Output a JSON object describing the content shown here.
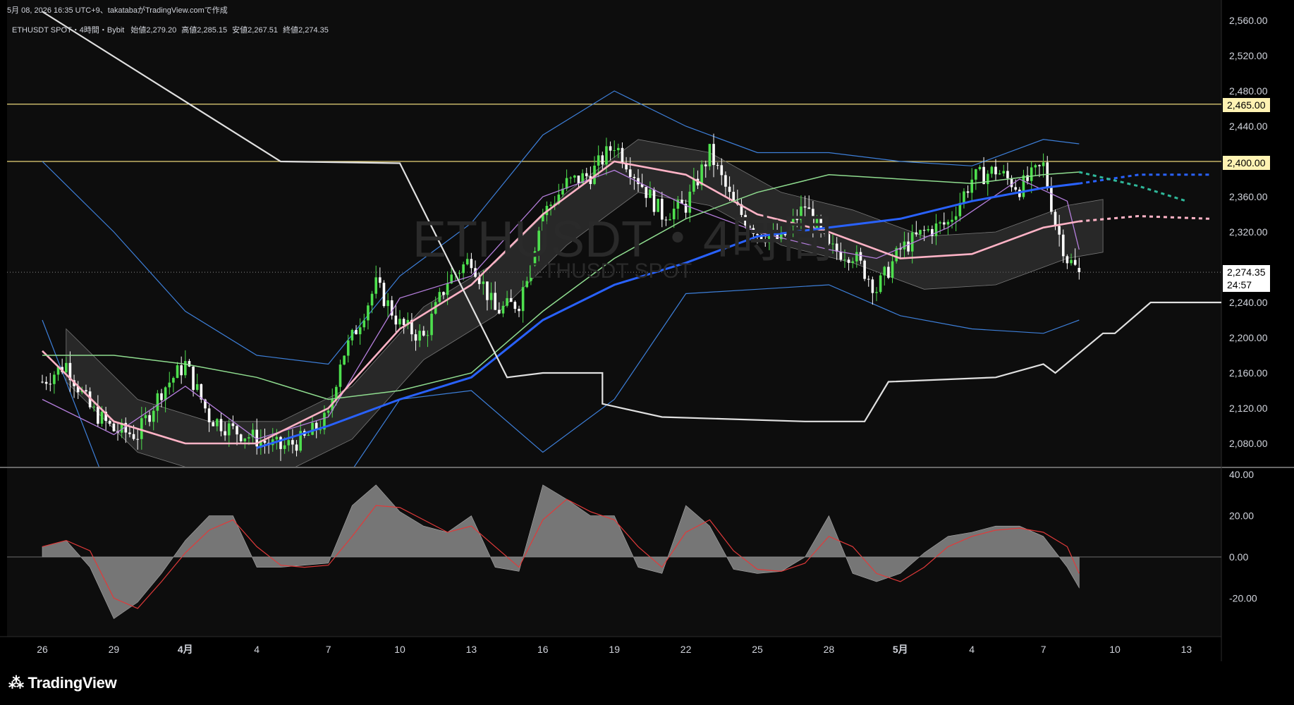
{
  "header": {
    "created_line": "5月 08, 2026 16:35 UTC+9、takatabaがTradingView.comで作成",
    "symbol_line": "ETHUSDT SPOT・4時間・Bybit",
    "open_label": "始値",
    "open_value": "2,279.20",
    "high_label": "高値",
    "high_value": "2,285.15",
    "low_label": "安値",
    "low_value": "2,267.51",
    "close_label": "終値",
    "close_value": "2,274.35"
  },
  "watermark": {
    "line1": "ETHUSDT・4時間",
    "line2": "ETHUSDT SPOT"
  },
  "price_scale": {
    "ticks": [
      "2,560.00",
      "2,520.00",
      "2,480.00",
      "2,440.00",
      "2,360.00",
      "2,320.00",
      "2,240.00",
      "2,200.00",
      "2,160.00",
      "2,120.00",
      "2,080.00"
    ],
    "tick_values": [
      2560,
      2520,
      2480,
      2440,
      2360,
      2320,
      2240,
      2200,
      2160,
      2120,
      2080
    ],
    "resistance_1": "2,465.00",
    "resistance_2": "2,400.00",
    "last_price": "2,274.35",
    "countdown": "24:57"
  },
  "oscillator_scale": {
    "ticks": [
      "40.00",
      "20.00",
      "0.00",
      "-20.00"
    ],
    "tick_values": [
      40,
      20,
      0,
      -20
    ]
  },
  "time_axis": {
    "labels": [
      "26",
      "29",
      "4月",
      "4",
      "7",
      "10",
      "13",
      "16",
      "19",
      "22",
      "25",
      "28",
      "5月",
      "4",
      "7",
      "10",
      "13"
    ],
    "positions": [
      0,
      3,
      6,
      9,
      12,
      15,
      18,
      21,
      24,
      27,
      30,
      33,
      36,
      39,
      42,
      45,
      48
    ],
    "bold": [
      false,
      false,
      true,
      false,
      false,
      false,
      false,
      false,
      false,
      false,
      false,
      false,
      true,
      false,
      false,
      false,
      false
    ]
  },
  "brand": "TradingView",
  "colors": {
    "background": "#000000",
    "bull": "#4ee04e",
    "bear": "#ffffff",
    "ma_fast": "#b57edc",
    "ma_mid": "#ffb3c6",
    "ma_slow": "#2962ff",
    "ma_green": "#8fdc8f",
    "bollinger": "#3d7fd9",
    "chikou": "#e0e0e0",
    "level_line": "#e8d47a",
    "macd_hist": "#8a8a8a",
    "macd_signal": "#e03a3a"
  },
  "chart_data": [
    {
      "type": "candlestick",
      "symbol": "ETHUSDT SPOT",
      "interval": "4時間",
      "exchange": "Bybit",
      "x_unit": "days since Mar 26, 2026 00:00",
      "ylim": [
        2060,
        2570
      ],
      "horizontal_levels": [
        2465,
        2400
      ],
      "last": {
        "open": 2279.2,
        "high": 2285.15,
        "low": 2267.51,
        "close": 2274.35
      },
      "candle_anchor_points": [
        [
          0,
          2150
        ],
        [
          1,
          2170
        ],
        [
          2,
          2120
        ],
        [
          3,
          2095
        ],
        [
          4,
          2090
        ],
        [
          5,
          2140
        ],
        [
          6,
          2170
        ],
        [
          7,
          2110
        ],
        [
          8,
          2095
        ],
        [
          9,
          2085
        ],
        [
          10,
          2075
        ],
        [
          11,
          2085
        ],
        [
          12,
          2110
        ],
        [
          12.5,
          2175
        ],
        [
          13,
          2200
        ],
        [
          14,
          2260
        ],
        [
          15,
          2215
        ],
        [
          16,
          2200
        ],
        [
          17,
          2265
        ],
        [
          18,
          2290
        ],
        [
          19,
          2230
        ],
        [
          20,
          2240
        ],
        [
          21,
          2340
        ],
        [
          22,
          2375
        ],
        [
          23,
          2385
        ],
        [
          24,
          2420
        ],
        [
          25,
          2380
        ],
        [
          26,
          2340
        ],
        [
          27,
          2350
        ],
        [
          28,
          2410
        ],
        [
          29,
          2350
        ],
        [
          30,
          2320
        ],
        [
          31,
          2310
        ],
        [
          32,
          2350
        ],
        [
          33,
          2300
        ],
        [
          34,
          2295
        ],
        [
          35,
          2255
        ],
        [
          36,
          2300
        ],
        [
          37,
          2320
        ],
        [
          38,
          2330
        ],
        [
          39,
          2380
        ],
        [
          40,
          2390
        ],
        [
          41,
          2370
        ],
        [
          42,
          2395
        ],
        [
          42.5,
          2330
        ],
        [
          43,
          2290
        ],
        [
          43.5,
          2274.35
        ]
      ],
      "moving_averages": [
        {
          "name": "fast",
          "points": [
            [
              0,
              2130
            ],
            [
              3,
              2090
            ],
            [
              6,
              2145
            ],
            [
              9,
              2085
            ],
            [
              12,
              2110
            ],
            [
              15,
              2245
            ],
            [
              18,
              2270
            ],
            [
              21,
              2360
            ],
            [
              24,
              2390
            ],
            [
              27,
              2350
            ],
            [
              30,
              2320
            ],
            [
              33,
              2300
            ],
            [
              35,
              2290
            ],
            [
              38,
              2325
            ],
            [
              41,
              2380
            ],
            [
              43,
              2355
            ],
            [
              43.5,
              2300
            ]
          ]
        },
        {
          "name": "mid",
          "points": [
            [
              0,
              2185
            ],
            [
              3,
              2105
            ],
            [
              6,
              2080
            ],
            [
              9,
              2080
            ],
            [
              12,
              2120
            ],
            [
              15,
              2210
            ],
            [
              18,
              2260
            ],
            [
              21,
              2340
            ],
            [
              24,
              2400
            ],
            [
              27,
              2385
            ],
            [
              30,
              2340
            ],
            [
              33,
              2320
            ],
            [
              36,
              2290
            ],
            [
              39,
              2295
            ],
            [
              42,
              2325
            ],
            [
              43.5,
              2332
            ]
          ]
        },
        {
          "name": "slow",
          "points": [
            [
              9,
              2075
            ],
            [
              12,
              2100
            ],
            [
              15,
              2130
            ],
            [
              18,
              2155
            ],
            [
              21,
              2220
            ],
            [
              24,
              2260
            ],
            [
              27,
              2285
            ],
            [
              30,
              2315
            ],
            [
              33,
              2325
            ],
            [
              36,
              2335
            ],
            [
              39,
              2355
            ],
            [
              42,
              2370
            ],
            [
              43.5,
              2375
            ]
          ]
        },
        {
          "name": "green",
          "points": [
            [
              0,
              2180
            ],
            [
              3,
              2180
            ],
            [
              6,
              2170
            ],
            [
              9,
              2155
            ],
            [
              12,
              2130
            ],
            [
              15,
              2140
            ],
            [
              18,
              2160
            ],
            [
              21,
              2230
            ],
            [
              24,
              2290
            ],
            [
              27,
              2335
            ],
            [
              30,
              2365
            ],
            [
              33,
              2385
            ],
            [
              36,
              2380
            ],
            [
              39,
              2375
            ],
            [
              42,
              2385
            ],
            [
              43.5,
              2388
            ]
          ]
        }
      ],
      "projections": [
        {
          "name": "slow_proj",
          "points": [
            [
              43.5,
              2375
            ],
            [
              46,
              2385
            ],
            [
              49,
              2385
            ]
          ]
        },
        {
          "name": "mid_proj",
          "points": [
            [
              43.5,
              2332
            ],
            [
              46,
              2338
            ],
            [
              49,
              2335
            ]
          ]
        },
        {
          "name": "green_proj",
          "points": [
            [
              43.5,
              2388
            ],
            [
              46,
              2372
            ],
            [
              48,
              2355
            ]
          ]
        }
      ],
      "bollinger": {
        "upper": [
          [
            0,
            2400
          ],
          [
            3,
            2320
          ],
          [
            6,
            2230
          ],
          [
            9,
            2180
          ],
          [
            12,
            2170
          ],
          [
            15,
            2270
          ],
          [
            18,
            2330
          ],
          [
            21,
            2430
          ],
          [
            24,
            2480
          ],
          [
            27,
            2440
          ],
          [
            30,
            2410
          ],
          [
            33,
            2410
          ],
          [
            36,
            2400
          ],
          [
            39,
            2395
          ],
          [
            42,
            2425
          ],
          [
            43.5,
            2420
          ]
        ],
        "lower": [
          [
            0,
            2220
          ],
          [
            3,
            2010
          ],
          [
            6,
            1990
          ],
          [
            9,
            1985
          ],
          [
            12,
            2010
          ],
          [
            15,
            2130
          ],
          [
            18,
            2140
          ],
          [
            21,
            2070
          ],
          [
            24,
            2130
          ],
          [
            27,
            2250
          ],
          [
            30,
            2255
          ],
          [
            33,
            2260
          ],
          [
            36,
            2225
          ],
          [
            39,
            2210
          ],
          [
            42,
            2205
          ],
          [
            43.5,
            2220
          ]
        ]
      },
      "chikou": [
        [
          0,
          2570
        ],
        [
          10,
          2400
        ],
        [
          15,
          2398
        ],
        [
          19.5,
          2155
        ],
        [
          21,
          2160
        ],
        [
          23.5,
          2160
        ],
        [
          23.5,
          2125
        ],
        [
          26,
          2110
        ],
        [
          32,
          2105
        ],
        [
          34.5,
          2105
        ],
        [
          35.5,
          2150
        ],
        [
          40,
          2155
        ],
        [
          42,
          2170
        ],
        [
          42.5,
          2160
        ],
        [
          44.5,
          2205
        ],
        [
          45,
          2205
        ],
        [
          46.5,
          2240
        ],
        [
          50,
          2240
        ]
      ]
    },
    {
      "type": "area",
      "name": "oscillator",
      "x_unit": "days since Mar 26, 2026 00:00",
      "ylim": [
        -40,
        42
      ],
      "histogram": [
        [
          0,
          5
        ],
        [
          1,
          8
        ],
        [
          2,
          -5
        ],
        [
          3,
          -30
        ],
        [
          4,
          -22
        ],
        [
          5,
          -8
        ],
        [
          6,
          8
        ],
        [
          7,
          20
        ],
        [
          8,
          20
        ],
        [
          9,
          -5
        ],
        [
          10,
          -5
        ],
        [
          11,
          -4
        ],
        [
          12,
          -3
        ],
        [
          13,
          25
        ],
        [
          14,
          35
        ],
        [
          15,
          22
        ],
        [
          16,
          15
        ],
        [
          17,
          12
        ],
        [
          18,
          20
        ],
        [
          19,
          -5
        ],
        [
          20,
          -7
        ],
        [
          21,
          35
        ],
        [
          22,
          28
        ],
        [
          23,
          20
        ],
        [
          24,
          20
        ],
        [
          25,
          -5
        ],
        [
          26,
          -8
        ],
        [
          27,
          25
        ],
        [
          28,
          15
        ],
        [
          29,
          -6
        ],
        [
          30,
          -8
        ],
        [
          31,
          -7
        ],
        [
          32,
          0
        ],
        [
          33,
          20
        ],
        [
          34,
          -8
        ],
        [
          35,
          -12
        ],
        [
          36,
          -8
        ],
        [
          37,
          2
        ],
        [
          38,
          10
        ],
        [
          39,
          12
        ],
        [
          40,
          15
        ],
        [
          41,
          15
        ],
        [
          42,
          10
        ],
        [
          43,
          -5
        ],
        [
          43.5,
          -15
        ]
      ],
      "signal": [
        [
          0,
          5
        ],
        [
          1,
          8
        ],
        [
          2,
          3
        ],
        [
          3,
          -20
        ],
        [
          4,
          -25
        ],
        [
          5,
          -12
        ],
        [
          6,
          2
        ],
        [
          7,
          13
        ],
        [
          8,
          18
        ],
        [
          9,
          5
        ],
        [
          10,
          -4
        ],
        [
          11,
          -5
        ],
        [
          12,
          -4
        ],
        [
          13,
          10
        ],
        [
          14,
          25
        ],
        [
          15,
          24
        ],
        [
          16,
          18
        ],
        [
          17,
          12
        ],
        [
          18,
          15
        ],
        [
          19,
          5
        ],
        [
          20,
          -5
        ],
        [
          21,
          18
        ],
        [
          22,
          28
        ],
        [
          23,
          22
        ],
        [
          24,
          18
        ],
        [
          25,
          5
        ],
        [
          26,
          -5
        ],
        [
          27,
          12
        ],
        [
          28,
          18
        ],
        [
          29,
          3
        ],
        [
          30,
          -6
        ],
        [
          31,
          -7
        ],
        [
          32,
          -3
        ],
        [
          33,
          10
        ],
        [
          34,
          5
        ],
        [
          35,
          -8
        ],
        [
          36,
          -12
        ],
        [
          37,
          -5
        ],
        [
          38,
          5
        ],
        [
          39,
          10
        ],
        [
          40,
          13
        ],
        [
          41,
          14
        ],
        [
          42,
          12
        ],
        [
          43,
          5
        ],
        [
          43.5,
          -8
        ]
      ]
    }
  ]
}
